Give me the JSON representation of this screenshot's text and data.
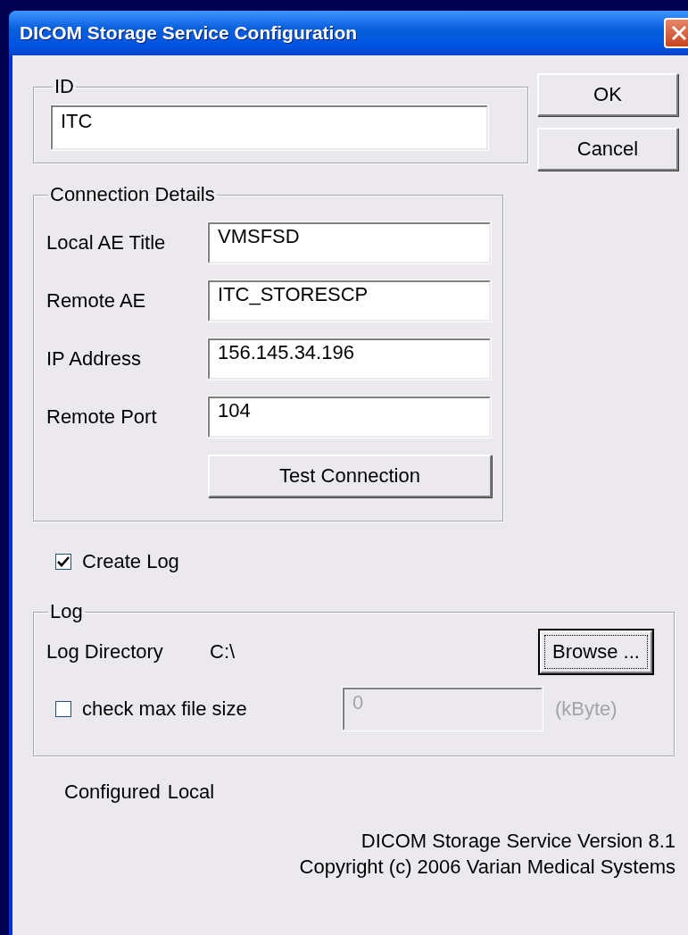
{
  "window": {
    "title": "DICOM Storage Service Configuration"
  },
  "id_group": {
    "label": "ID",
    "value": "ITC"
  },
  "buttons": [
    {
      "label": "OK"
    },
    {
      "label": "Cancel"
    }
  ],
  "connection": {
    "label": "Connection Details",
    "fields": [
      {
        "label": "Local AE Title",
        "value": "VMSFSD"
      },
      {
        "label": "Remote AE",
        "value": "ITC_STORESCP"
      },
      {
        "label": "IP Address",
        "value": "156.145.34.196"
      },
      {
        "label": "Remote Port",
        "value": "104"
      }
    ],
    "test_button": "Test Connection"
  },
  "create_log": {
    "label": "Create Log",
    "checked": true
  },
  "log": {
    "label": "Log",
    "directory_label": "Log Directory",
    "directory": "C:\\",
    "browse_button": {
      "label": "Browse ...",
      "focused": true
    },
    "max_size": {
      "label": "check max file size",
      "checked": false,
      "value": "0",
      "unit": "(kByte)",
      "disabled": true
    }
  },
  "status": [
    "Configured",
    "Local"
  ],
  "footer": [
    "DICOM Storage Service Version 8.1",
    "Copyright (c) 2006 Varian Medical Systems"
  ]
}
